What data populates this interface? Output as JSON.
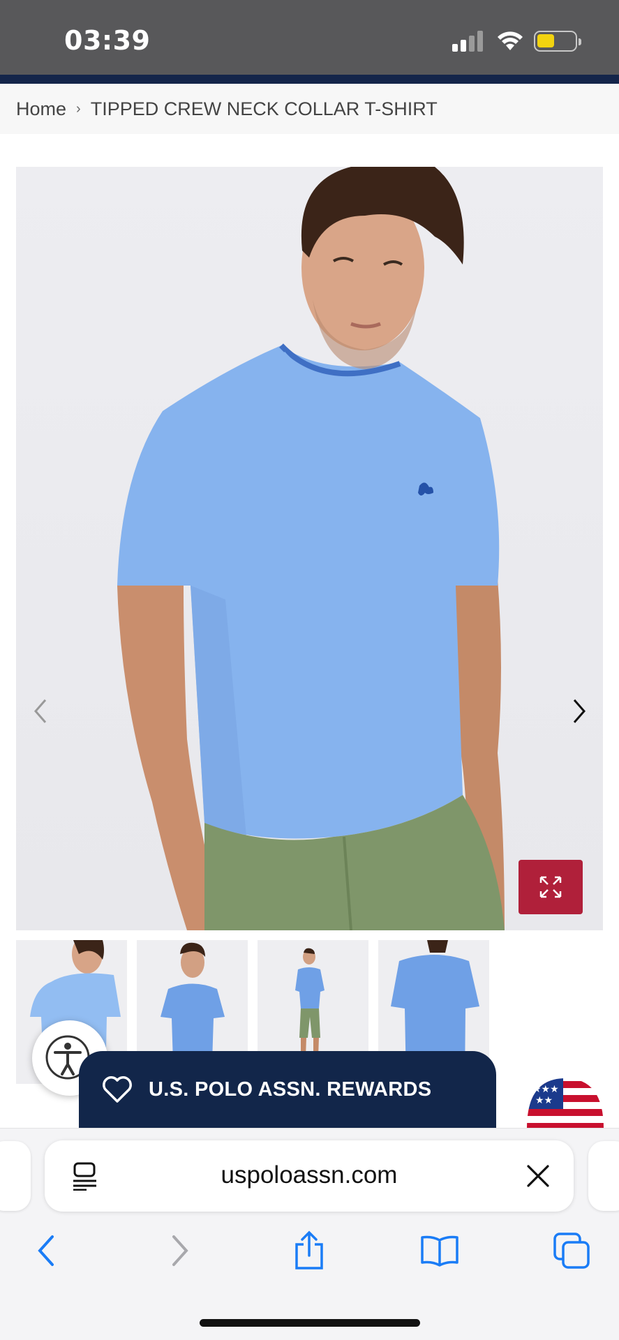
{
  "status_bar": {
    "time": "03:39"
  },
  "breadcrumb": {
    "home": "Home",
    "separator": "›",
    "current": "TIPPED CREW NECK COLLAR T-SHIRT"
  },
  "product": {
    "image_icons": {
      "prev": "chevron-left-icon",
      "next": "chevron-right-icon",
      "expand": "expand-icon"
    },
    "thumbnail_count": 4
  },
  "rewards": {
    "label": "U.S. POLO ASSN. REWARDS",
    "icon": "heart-icon"
  },
  "browser": {
    "url": "uspoloassn.com",
    "toolbar": [
      "back-icon",
      "forward-icon",
      "share-icon",
      "bookmarks-icon",
      "tabs-icon"
    ]
  },
  "colors": {
    "navy": "#12264a",
    "accent_red": "#b0203a",
    "ios_blue": "#1a7cf6",
    "shirt_blue": "#86b3ee",
    "pants_green": "#7f966a"
  }
}
